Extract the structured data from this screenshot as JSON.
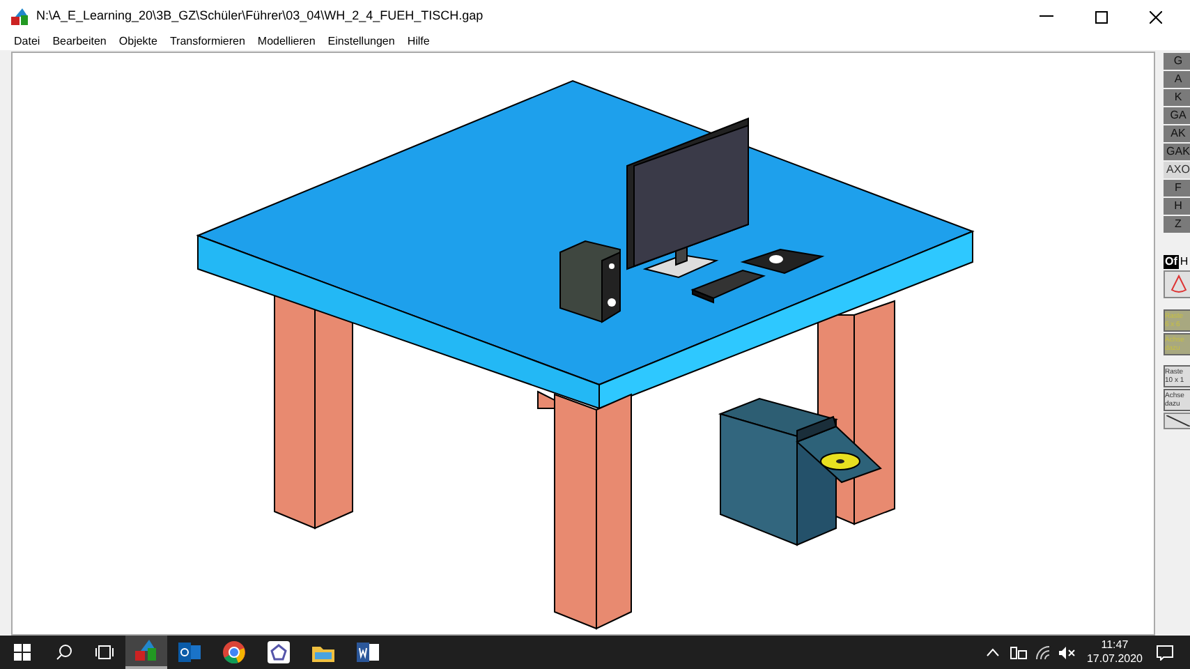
{
  "window": {
    "title": "N:\\A_E_Learning_20\\3B_GZ\\Schüler\\Führer\\03_04\\WH_2_4_FUEH_TISCH.gap"
  },
  "menu": [
    "Datei",
    "Bearbeiten",
    "Objekte",
    "Transformieren",
    "Modellieren",
    "Einstellungen",
    "Hilfe"
  ],
  "view_buttons": [
    {
      "label": "G",
      "selected": false
    },
    {
      "label": "A",
      "selected": false
    },
    {
      "label": "K",
      "selected": false
    },
    {
      "label": "GA",
      "selected": false
    },
    {
      "label": "AK",
      "selected": false
    },
    {
      "label": "GAK",
      "selected": false
    },
    {
      "label": "AXO",
      "selected": true
    },
    {
      "label": "F",
      "selected": false
    },
    {
      "label": "H",
      "selected": false
    },
    {
      "label": "Z",
      "selected": false
    }
  ],
  "mode": {
    "label_1": "Of",
    "label_2": "H"
  },
  "grid_buttons": [
    {
      "label": "Raste",
      "sublabel": "6 x 6",
      "active": true
    },
    {
      "label": "Achse",
      "sublabel": "dazu",
      "active": true
    },
    {
      "label": "Raste",
      "sublabel": "10 x 1",
      "active": false
    },
    {
      "label": "Achse",
      "sublabel": "dazu",
      "active": false
    }
  ],
  "taskbar": {
    "time": "11:47",
    "date": "17.07.2020"
  }
}
